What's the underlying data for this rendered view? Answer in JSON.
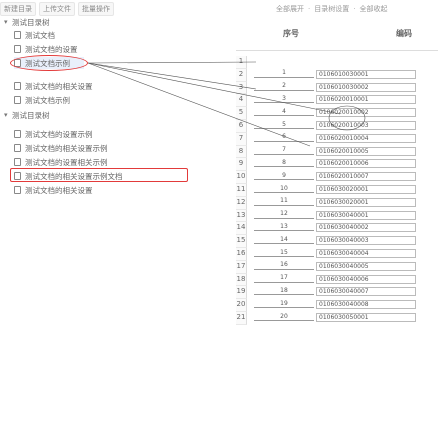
{
  "toolbar_left": {
    "items": [
      "新建目录",
      "上传文件",
      "批量操作"
    ],
    "sep": "|"
  },
  "toolbar_right": {
    "items": [
      "全部展开",
      "目录树设置",
      "全部收起"
    ],
    "sep": "·"
  },
  "tree": {
    "rows": [
      {
        "caret": "▾",
        "label": "测试目录树",
        "level": 0
      },
      {
        "caret": "",
        "label": "测试文档",
        "level": 1
      },
      {
        "caret": "",
        "label": "测试文档的设置",
        "level": 1
      },
      {
        "caret": "",
        "label": "测试文档示例",
        "level": 1
      },
      {
        "caret": "",
        "label": "测试文档的相关设置",
        "level": 1
      },
      {
        "caret": "",
        "label": "测试文档示例",
        "level": 1
      },
      {
        "caret": "▾",
        "label": "测试目录树",
        "level": 0
      },
      {
        "caret": "",
        "label": "测试文档的设置示例",
        "level": 1
      },
      {
        "caret": "",
        "label": "测试文档的相关设置示例",
        "level": 1
      },
      {
        "caret": "",
        "label": "测试文档的设置相关示例",
        "level": 1
      },
      {
        "caret": "",
        "label": "测试文档的相关设置示例文档",
        "level": 1
      },
      {
        "caret": "",
        "label": "测试文档的相关设置",
        "level": 1
      }
    ]
  },
  "grid": {
    "headers": [
      "序号",
      "编码"
    ],
    "rows": [
      {
        "num": "1",
        "seq": "",
        "code": ""
      },
      {
        "num": "2",
        "seq": "1",
        "code": "0106010030001"
      },
      {
        "num": "3",
        "seq": "2",
        "code": "0106010030002"
      },
      {
        "num": "4",
        "seq": "3",
        "code": "0106020010001"
      },
      {
        "num": "5",
        "seq": "4",
        "code": "0106020010002"
      },
      {
        "num": "6",
        "seq": "5",
        "code": "0106020010003"
      },
      {
        "num": "7",
        "seq": "6",
        "code": "0106020010004"
      },
      {
        "num": "8",
        "seq": "7",
        "code": "0106020010005"
      },
      {
        "num": "9",
        "seq": "8",
        "code": "0106020010006"
      },
      {
        "num": "10",
        "seq": "9",
        "code": "0106020010007"
      },
      {
        "num": "11",
        "seq": "10",
        "code": "0106030020001"
      },
      {
        "num": "12",
        "seq": "11",
        "code": "0106030020001"
      },
      {
        "num": "13",
        "seq": "12",
        "code": "0106030040001"
      },
      {
        "num": "14",
        "seq": "13",
        "code": "0106030040002"
      },
      {
        "num": "15",
        "seq": "14",
        "code": "0106030040003"
      },
      {
        "num": "16",
        "seq": "15",
        "code": "0106030040004"
      },
      {
        "num": "17",
        "seq": "16",
        "code": "0106030040005"
      },
      {
        "num": "18",
        "seq": "17",
        "code": "0106030040006"
      },
      {
        "num": "19",
        "seq": "18",
        "code": "0106030040007"
      },
      {
        "num": "20",
        "seq": "19",
        "code": "0106030040008"
      },
      {
        "num": "21",
        "seq": "20",
        "code": "0106030050001"
      }
    ]
  },
  "colors": {
    "highlight": "#e23a3a",
    "selected": "#e9f0fb",
    "code_border": "#bbbbbb"
  }
}
